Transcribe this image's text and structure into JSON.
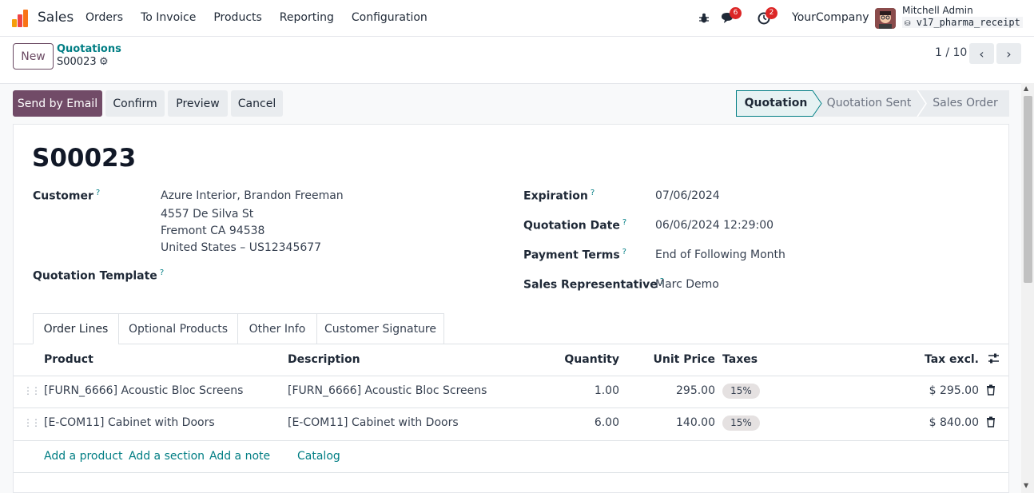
{
  "navbar": {
    "app_name": "Sales",
    "menu": [
      "Orders",
      "To Invoice",
      "Products",
      "Reporting",
      "Configuration"
    ],
    "messages_count": "6",
    "activities_count": "2",
    "company": "YourCompany",
    "user_name": "Mitchell Admin",
    "db_name": "v17_pharma_receipt"
  },
  "control_panel": {
    "new_label": "New",
    "breadcrumb_parent": "Quotations",
    "breadcrumb_current": "S00023",
    "pager_value": "1 / 10"
  },
  "actions": {
    "send_email": "Send by Email",
    "confirm": "Confirm",
    "preview": "Preview",
    "cancel": "Cancel"
  },
  "status": {
    "stages": [
      "Quotation",
      "Quotation Sent",
      "Sales Order"
    ],
    "current": "Quotation"
  },
  "record": {
    "name": "S00023",
    "customer_label": "Customer",
    "customer_lines": [
      "Azure Interior, Brandon Freeman",
      "4557 De Silva St",
      "Fremont CA 94538",
      "United States – US12345677"
    ],
    "template_label": "Quotation Template",
    "expiration_label": "Expiration",
    "expiration_value": "07/06/2024",
    "quotation_date_label": "Quotation Date",
    "quotation_date_value": "06/06/2024 12:29:00",
    "payment_terms_label": "Payment Terms",
    "payment_terms_value": "End of Following Month",
    "sales_rep_label": "Sales Representative",
    "sales_rep_value": "Marc Demo",
    "help_mark": "?"
  },
  "tabs": [
    "Order Lines",
    "Optional Products",
    "Other Info",
    "Customer Signature"
  ],
  "order_lines": {
    "headers": {
      "product": "Product",
      "description": "Description",
      "quantity": "Quantity",
      "unit_price": "Unit Price",
      "taxes": "Taxes",
      "tax_excl": "Tax excl."
    },
    "rows": [
      {
        "product": "[FURN_6666] Acoustic Bloc Screens",
        "description": "[FURN_6666] Acoustic Bloc Screens",
        "quantity": "1.00",
        "unit_price": "295.00",
        "tax": "15%",
        "subtotal": "$ 295.00"
      },
      {
        "product": "[E-COM11] Cabinet with Doors",
        "description": "[E-COM11] Cabinet with Doors",
        "quantity": "6.00",
        "unit_price": "140.00",
        "tax": "15%",
        "subtotal": "$ 840.00"
      }
    ],
    "add_links": {
      "add_product": "Add a product",
      "add_section": "Add a section",
      "add_note": "Add a note",
      "catalog": "Catalog"
    }
  },
  "colors": {
    "brand": "#714b67",
    "link": "#017e84",
    "badge": "#dc2626"
  }
}
